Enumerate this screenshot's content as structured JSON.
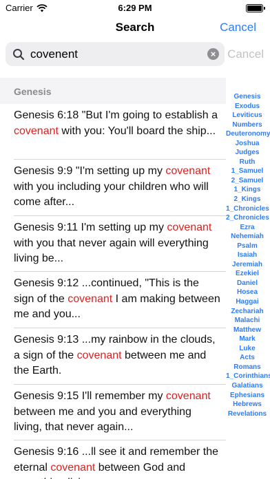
{
  "status": {
    "carrier": "Carrier",
    "time": "6:29 PM"
  },
  "nav": {
    "title": "Search",
    "cancel_label": "Cancel"
  },
  "search": {
    "value": "covenent",
    "cancel_label": "Cancel"
  },
  "section": {
    "title": "Genesis"
  },
  "results": [
    {
      "before": "Genesis 6:18 \"But I'm going to establish a ",
      "match": "covenant",
      "after": " with you: You'll board the ship..."
    },
    {
      "before": "Genesis 9:9 \"I'm setting up my ",
      "match": "covenant",
      "after": " with you including your children who will come after..."
    },
    {
      "before": "Genesis 9:11 I'm setting up my ",
      "match": "covenant",
      "after": " with you that never again will everything living be..."
    },
    {
      "before": "Genesis 9:12 ...continued, \"This is the sign of the ",
      "match": "covenant",
      "after": " I am making between me and you..."
    },
    {
      "before": "Genesis 9:13 ...my rainbow in the clouds, a sign of the ",
      "match": "covenant",
      "after": " between me and the Earth."
    },
    {
      "before": "Genesis 9:15 I'll remember my ",
      "match": "covenant",
      "after": " between me and you and everything living, that never again..."
    },
    {
      "before": "Genesis 9:16 ...ll see it and remember the eternal ",
      "match": "covenant",
      "after": " between God and everything living ..."
    }
  ],
  "index": [
    "Genesis",
    "Exodus",
    "Leviticus",
    "Numbers",
    "Deuteronomy",
    "Joshua",
    "Judges",
    "Ruth",
    "1_Samuel",
    "2_Samuel",
    "1_Kings",
    "2_Kings",
    "1_Chronicles",
    "2_Chronicles",
    "Ezra",
    "Nehemiah",
    "Psalm",
    "Isaiah",
    "Jeremiah",
    "Ezekiel",
    "Daniel",
    "Hosea",
    "Haggai",
    "Zechariah",
    "Malachi",
    "Matthew",
    "Mark",
    "Luke",
    "Acts",
    "Romans",
    "1_Corinthians",
    "Galatians",
    "Ephesians",
    "Hebrews",
    "Revelations"
  ],
  "colors": {
    "accent": "#2f7cf6",
    "highlight": "#e0201f"
  },
  "icons": {
    "wifi": "wifi-icon",
    "battery": "battery-icon",
    "search": "search-icon",
    "clear": "clear-icon"
  }
}
